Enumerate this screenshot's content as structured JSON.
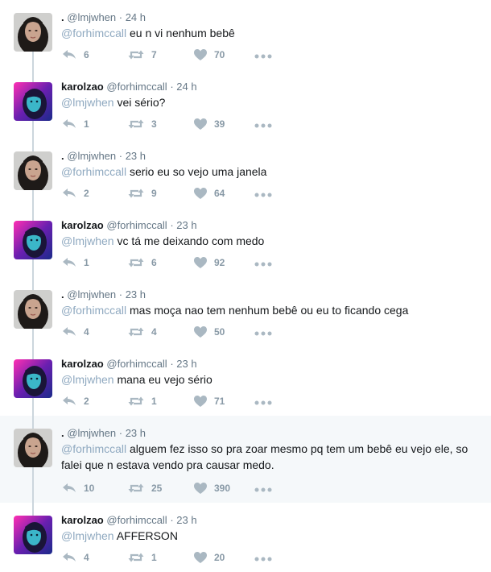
{
  "icons": {
    "reply": "reply-icon",
    "retweet": "retweet-icon",
    "like": "heart-icon",
    "more": "more-icon",
    "color": "#aab8c2"
  },
  "tweets": [
    {
      "author": "girl",
      "name": ".",
      "handle": "@lmjwhen",
      "time": "24 h",
      "mention": "@forhimccall",
      "text": "eu n vi nenhum bebê",
      "replies": "6",
      "retweets": "7",
      "likes": "70"
    },
    {
      "author": "karol",
      "name": "karolzao",
      "handle": "@forhimccall",
      "time": "24 h",
      "mention": "@lmjwhen",
      "text": "vei sério?",
      "replies": "1",
      "retweets": "3",
      "likes": "39"
    },
    {
      "author": "girl",
      "name": ".",
      "handle": "@lmjwhen",
      "time": "23 h",
      "mention": "@forhimccall",
      "text": "serio eu so vejo uma janela",
      "replies": "2",
      "retweets": "9",
      "likes": "64"
    },
    {
      "author": "karol",
      "name": "karolzao",
      "handle": "@forhimccall",
      "time": "23 h",
      "mention": "@lmjwhen",
      "text": "vc tá me deixando com medo",
      "replies": "1",
      "retweets": "6",
      "likes": "92"
    },
    {
      "author": "girl",
      "name": ".",
      "handle": "@lmjwhen",
      "time": "23 h",
      "mention": "@forhimccall",
      "text": "mas moça nao tem nenhum bebê ou eu to ficando cega",
      "replies": "4",
      "retweets": "4",
      "likes": "50"
    },
    {
      "author": "karol",
      "name": "karolzao",
      "handle": "@forhimccall",
      "time": "23 h",
      "mention": "@lmjwhen",
      "text": "mana eu vejo sério",
      "replies": "2",
      "retweets": "1",
      "likes": "71"
    },
    {
      "author": "girl",
      "name": ".",
      "handle": "@lmjwhen",
      "time": "23 h",
      "mention": "@forhimccall",
      "text": "alguem fez isso so pra zoar mesmo pq tem um bebê eu vejo ele, so falei que n estava vendo pra causar medo.",
      "replies": "10",
      "retweets": "25",
      "likes": "390",
      "highlighted": true
    },
    {
      "author": "karol",
      "name": "karolzao",
      "handle": "@forhimccall",
      "time": "23 h",
      "mention": "@lmjwhen",
      "text": "AFFERSON",
      "replies": "4",
      "retweets": "1",
      "likes": "20"
    }
  ]
}
